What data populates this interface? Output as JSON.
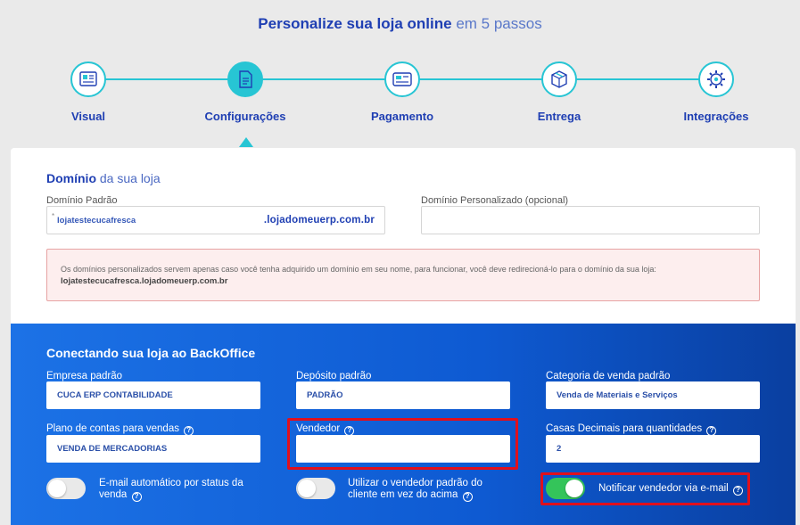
{
  "header": {
    "title_bold": "Personalize sua loja online",
    "title_light": "em 5 passos"
  },
  "steps": [
    {
      "label": "Visual",
      "icon": "layout-icon"
    },
    {
      "label": "Configurações",
      "icon": "document-icon",
      "active": true
    },
    {
      "label": "Pagamento",
      "icon": "payment-icon"
    },
    {
      "label": "Entrega",
      "icon": "box-icon"
    },
    {
      "label": "Integrações",
      "icon": "gear-icon"
    }
  ],
  "domain_section": {
    "title_bold": "Domínio",
    "title_light": "da sua loja",
    "default_label": "Domínio Padrão",
    "default_prefix_mark": "*",
    "default_value": "lojatestecucafresca",
    "default_suffix": ".lojadomeuerp.com.br",
    "custom_label": "Domínio Personalizado (opcional)",
    "custom_value": "",
    "alert_text": "Os domínios personalizados servem apenas caso você tenha adquirido um domínio em seu nome, para funcionar, você deve redirecioná-lo para o domínio da sua loja:",
    "alert_domain": "lojatestecucafresca.lojadomeuerp.com.br"
  },
  "backoffice": {
    "title": "Conectando sua loja ao BackOffice",
    "fields": {
      "empresa": {
        "label": "Empresa padrão",
        "value": "CUCA ERP CONTABILIDADE"
      },
      "deposito": {
        "label": "Depósito padrão",
        "value": "PADRÃO"
      },
      "categoria": {
        "label": "Categoria de venda padrão",
        "value": "Venda de Materiais e Serviços"
      },
      "plano": {
        "label": "Plano de contas para vendas",
        "value": "VENDA DE MERCADORIAS"
      },
      "vendedor": {
        "label": "Vendedor",
        "value": ""
      },
      "casas": {
        "label": "Casas Decimais para quantidades",
        "value": "2"
      }
    },
    "toggles": {
      "email_status": {
        "label_line1": "E-mail automático por status da",
        "label_line2": "venda",
        "on": false
      },
      "vendedor_padrao": {
        "label_line1": "Utilizar o vendedor padrão do",
        "label_line2": "cliente em vez do acima",
        "on": false
      },
      "notificar": {
        "label": "Notificar vendedor via e-mail",
        "on": true
      }
    },
    "help_glyph": "?"
  },
  "colors": {
    "accent": "#27c5d4",
    "brand_blue": "#1f3fb3",
    "toggle_on": "#34c45a",
    "highlight": "#e0101d"
  }
}
